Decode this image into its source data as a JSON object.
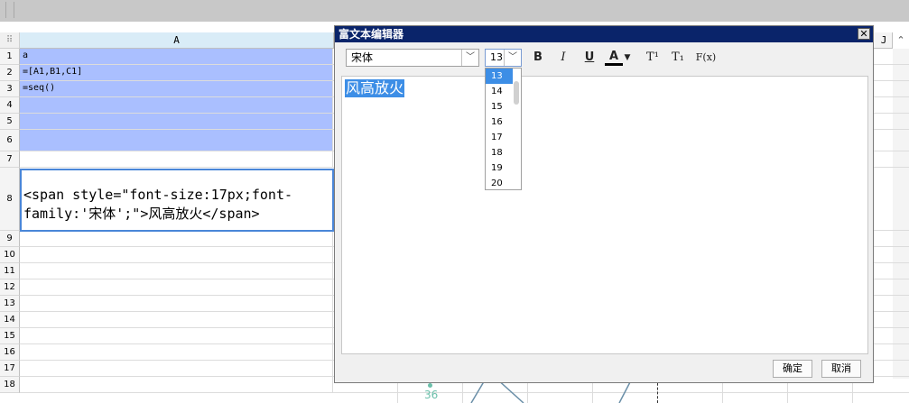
{
  "sheet": {
    "column_a_header": "A",
    "column_j_header": "J",
    "corner_symbol": "⠿",
    "rows": [
      {
        "num": "1",
        "value": "a"
      },
      {
        "num": "2",
        "value": "=[A1,B1,C1]"
      },
      {
        "num": "3",
        "value": "=seq()"
      },
      {
        "num": "4",
        "value": ""
      },
      {
        "num": "5",
        "value": ""
      },
      {
        "num": "6",
        "value": ""
      },
      {
        "num": "7",
        "value": ""
      },
      {
        "num": "8",
        "value": "<span style=\"font-size:17px;font-family:'宋体';\">风高放火</span>"
      },
      {
        "num": "9",
        "value": ""
      },
      {
        "num": "10",
        "value": ""
      },
      {
        "num": "11",
        "value": ""
      },
      {
        "num": "12",
        "value": ""
      },
      {
        "num": "13",
        "value": ""
      },
      {
        "num": "14",
        "value": ""
      },
      {
        "num": "15",
        "value": ""
      },
      {
        "num": "16",
        "value": ""
      },
      {
        "num": "17",
        "value": ""
      },
      {
        "num": "18",
        "value": ""
      }
    ],
    "bottom_value": "36"
  },
  "dialog": {
    "title": "富文本编辑器",
    "close_label": "✕",
    "font_family_value": "宋体",
    "font_size_value": "13",
    "toolbar": {
      "bold": "B",
      "italic": "I",
      "underline": "U",
      "font_color": "A",
      "superscript": "T¹",
      "subscript": "T₁",
      "formula": "F(x)"
    },
    "size_options": [
      "13",
      "14",
      "15",
      "16",
      "17",
      "18",
      "19",
      "20"
    ],
    "selected_size": "13",
    "editor_text": "风高放火",
    "ok_label": "确定",
    "cancel_label": "取消"
  },
  "colors": {
    "selection": "#aabfff",
    "active_border": "#4a86d8",
    "title_bar": "#0a246a",
    "highlight": "#3d8ee6"
  }
}
